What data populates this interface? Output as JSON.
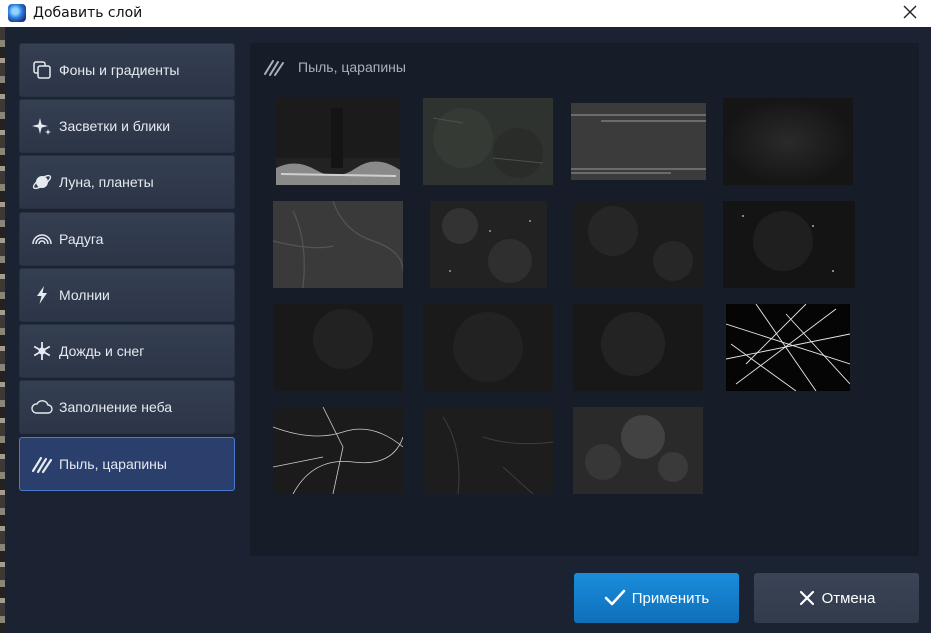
{
  "window": {
    "title": "Добавить слой",
    "app_icon": "app-logo-icon",
    "close_icon": "close-icon"
  },
  "sidebar": {
    "items": [
      {
        "label": "Фоны и градиенты",
        "icon": "layers-icon",
        "active": false
      },
      {
        "label": "Засветки и блики",
        "icon": "sparkle-icon",
        "active": false
      },
      {
        "label": "Луна, планеты",
        "icon": "planet-icon",
        "active": false
      },
      {
        "label": "Радуга",
        "icon": "rainbow-icon",
        "active": false
      },
      {
        "label": "Молнии",
        "icon": "lightning-icon",
        "active": false
      },
      {
        "label": "Дождь и снег",
        "icon": "snowflake-icon",
        "active": false
      },
      {
        "label": "Заполнение неба",
        "icon": "cloud-icon",
        "active": false
      },
      {
        "label": "Пыль, царапины",
        "icon": "scratches-icon",
        "active": true
      }
    ]
  },
  "content": {
    "title": "Пыль, царапины",
    "icon": "scratches-icon",
    "thumbnail_count": 15
  },
  "buttons": {
    "apply_label": "Применить",
    "cancel_label": "Отмена"
  },
  "colors": {
    "accent": "#1a8ddc",
    "active_item": "#2b3f6d",
    "active_border": "#4a7ad2"
  }
}
